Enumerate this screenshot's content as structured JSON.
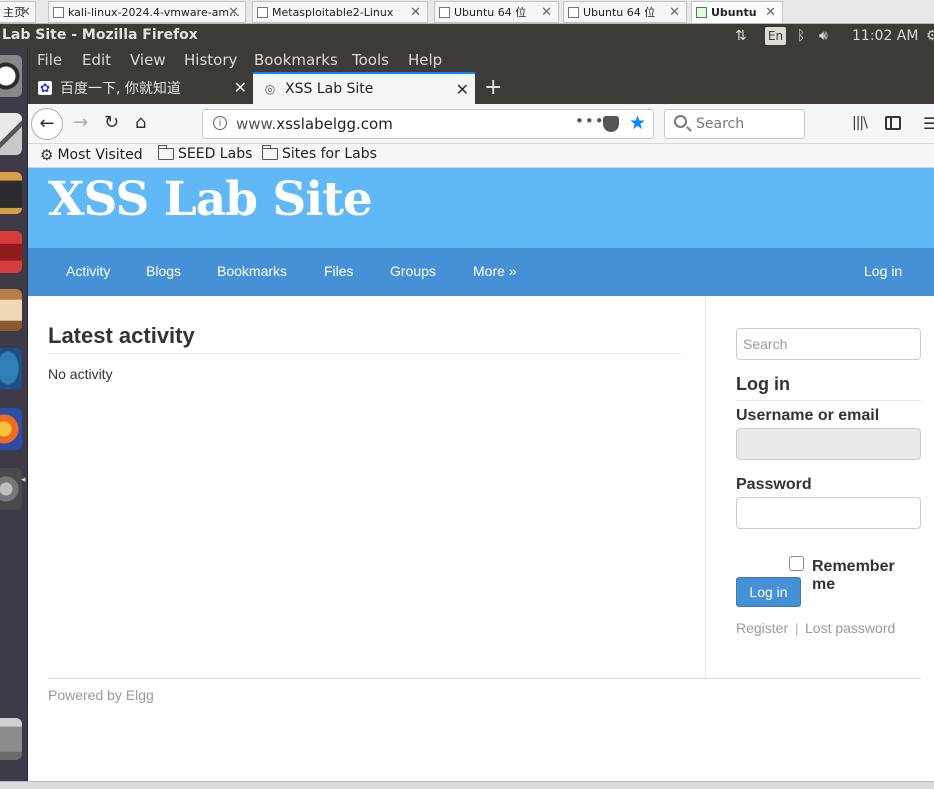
{
  "vm_tabs": [
    {
      "label": "主页"
    },
    {
      "label": "kali-linux-2024.4-vmware-am..."
    },
    {
      "label": "Metasploitable2-Linux"
    },
    {
      "label": "Ubuntu 64 位"
    },
    {
      "label": "Ubuntu 64 位"
    },
    {
      "label": "Ubuntu"
    }
  ],
  "top_panel": {
    "window_title": "Lab Site - Mozilla Firefox",
    "keyboard_layout": "En",
    "clock": "11:02 AM"
  },
  "menu": {
    "file": "File",
    "edit": "Edit",
    "view": "View",
    "history": "History",
    "bookmarks": "Bookmarks",
    "tools": "Tools",
    "help": "Help"
  },
  "tabs": [
    {
      "title": "百度一下, 你就知道"
    },
    {
      "title": "XSS Lab Site"
    }
  ],
  "url_bar": {
    "prefix": "www.",
    "domain": "xsslabelgg.com"
  },
  "browser_search": {
    "placeholder": "Search"
  },
  "bookmarks_bar": [
    {
      "label": "Most Visited"
    },
    {
      "label": "SEED Labs"
    },
    {
      "label": "Sites for Labs"
    }
  ],
  "site": {
    "title": "XSS Lab Site",
    "nav": [
      "Activity",
      "Blogs",
      "Bookmarks",
      "Files",
      "Groups",
      "More »"
    ],
    "nav_login": "Log in",
    "activity_heading": "Latest activity",
    "no_activity": "No activity",
    "search_placeholder": "Search",
    "login_heading": "Log in",
    "username_label": "Username or email",
    "password_label": "Password",
    "remember_label": "Remember me",
    "login_button": "Log in",
    "register_link": "Register",
    "link_separator": "|",
    "lost_password_link": "Lost password",
    "powered_by": "Powered by Elgg"
  },
  "colors": {
    "header_bg": "#60b8f7",
    "nav_bg": "#4690d6",
    "ubuntu_panel": "#3c3b37",
    "firefox_accent": "#0a84ff"
  }
}
